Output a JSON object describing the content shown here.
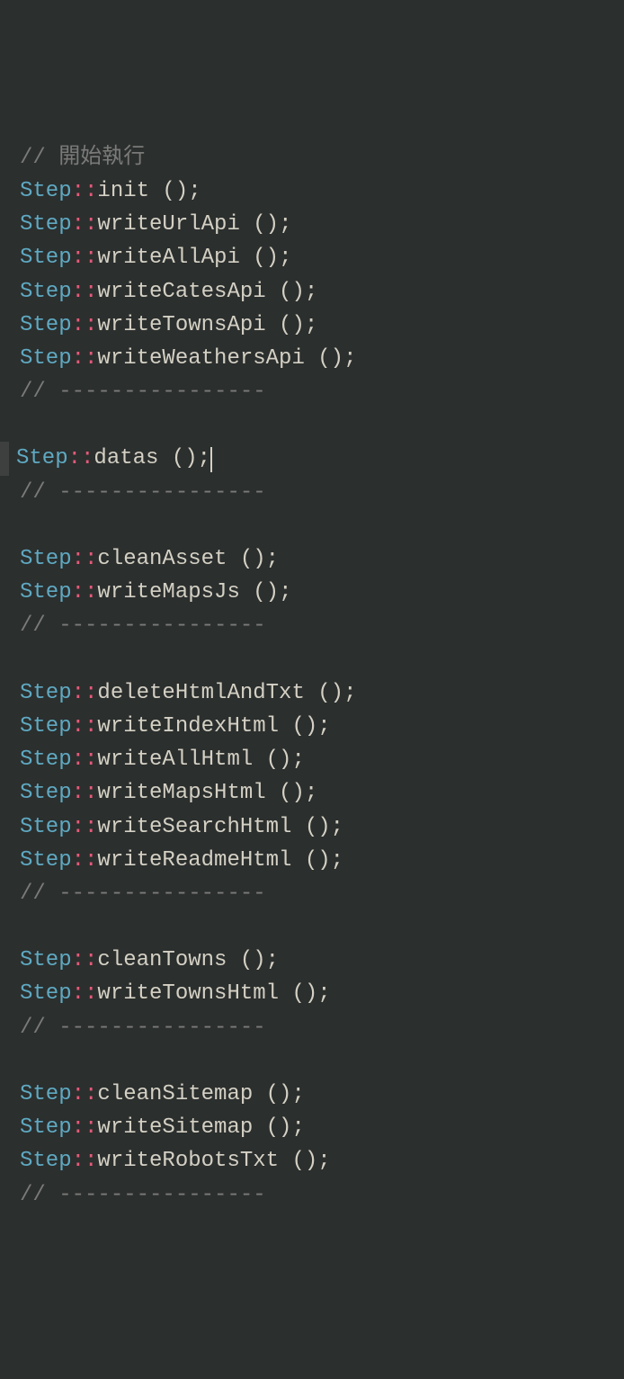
{
  "lines": [
    {
      "type": "comment",
      "text": "// 開始執行"
    },
    {
      "type": "call",
      "class": "Step",
      "method": "init"
    },
    {
      "type": "call",
      "class": "Step",
      "method": "writeUrlApi"
    },
    {
      "type": "call",
      "class": "Step",
      "method": "writeAllApi"
    },
    {
      "type": "call",
      "class": "Step",
      "method": "writeCatesApi"
    },
    {
      "type": "call",
      "class": "Step",
      "method": "writeTownsApi"
    },
    {
      "type": "call",
      "class": "Step",
      "method": "writeWeathersApi"
    },
    {
      "type": "comment",
      "text": "// ----------------"
    },
    {
      "type": "blank"
    },
    {
      "type": "call",
      "class": "Step",
      "method": "datas",
      "cursor": true,
      "active": true
    },
    {
      "type": "comment",
      "text": "// ----------------"
    },
    {
      "type": "blank"
    },
    {
      "type": "call",
      "class": "Step",
      "method": "cleanAsset"
    },
    {
      "type": "call",
      "class": "Step",
      "method": "writeMapsJs"
    },
    {
      "type": "comment",
      "text": "// ----------------"
    },
    {
      "type": "blank"
    },
    {
      "type": "call",
      "class": "Step",
      "method": "deleteHtmlAndTxt"
    },
    {
      "type": "call",
      "class": "Step",
      "method": "writeIndexHtml"
    },
    {
      "type": "call",
      "class": "Step",
      "method": "writeAllHtml"
    },
    {
      "type": "call",
      "class": "Step",
      "method": "writeMapsHtml"
    },
    {
      "type": "call",
      "class": "Step",
      "method": "writeSearchHtml"
    },
    {
      "type": "call",
      "class": "Step",
      "method": "writeReadmeHtml"
    },
    {
      "type": "comment",
      "text": "// ----------------"
    },
    {
      "type": "blank"
    },
    {
      "type": "call",
      "class": "Step",
      "method": "cleanTowns"
    },
    {
      "type": "call",
      "class": "Step",
      "method": "writeTownsHtml"
    },
    {
      "type": "comment",
      "text": "// ----------------"
    },
    {
      "type": "blank"
    },
    {
      "type": "call",
      "class": "Step",
      "method": "cleanSitemap"
    },
    {
      "type": "call",
      "class": "Step",
      "method": "writeSitemap"
    },
    {
      "type": "call",
      "class": "Step",
      "method": "writeRobotsTxt"
    },
    {
      "type": "comment",
      "text": "// ----------------"
    }
  ],
  "colors": {
    "background": "#2b2f2e",
    "comment": "#7a7a78",
    "class": "#5fa9c2",
    "scope": "#e55a7a",
    "text": "#d4d0c4"
  }
}
